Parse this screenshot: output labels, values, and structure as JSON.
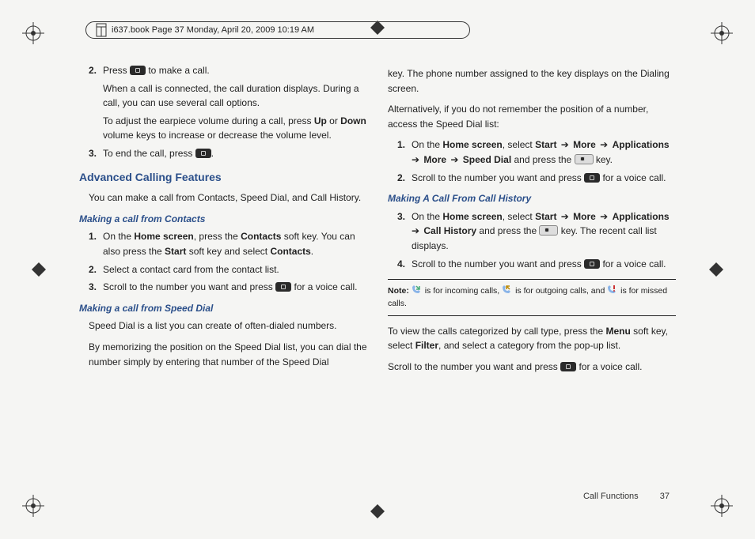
{
  "header": {
    "text": "i637.book  Page 37  Monday, April 20, 2009  10:19 AM"
  },
  "left": {
    "step2": {
      "num": "2.",
      "a": "Press ",
      "b": " to make a call."
    },
    "step2_p1": "When a call is connected, the call duration displays. During a call, you can use several call options.",
    "step2_p2a": "To adjust the earpiece volume during a call, press ",
    "step2_up": "Up",
    "step2_p2b": " or ",
    "step2_down": "Down",
    "step2_p2c": " volume keys to increase or decrease the volume level.",
    "step3": {
      "num": "3.",
      "a": "To end the call, press ",
      "b": "."
    },
    "sec_advanced": "Advanced Calling Features",
    "adv_intro": "You can make a call from Contacts, Speed Dial, and Call History.",
    "sub_contacts": "Making a call from Contacts",
    "c1": {
      "num": "1.",
      "a": "On the ",
      "home": "Home screen",
      "b": ", press the ",
      "contacts": "Contacts",
      "c": " soft key. You can also press the ",
      "start": "Start",
      "d": " soft key and select ",
      "contacts2": "Contacts",
      "e": "."
    },
    "c2": {
      "num": "2.",
      "a": "Select a contact card from the contact list."
    },
    "c3": {
      "num": "3.",
      "a": "Scroll to the number you want and press ",
      "b": " for a voice call."
    },
    "sub_speeddial": "Making a call from Speed Dial",
    "sd_p1": "Speed Dial is a list you can create of often-dialed numbers.",
    "sd_p2": "By memorizing the position on the Speed Dial list, you can dial the number simply by entering that number of the Speed Dial"
  },
  "right": {
    "top_p1": "key. The phone number assigned to the key displays on the Dialing screen.",
    "top_p2": "Alternatively, if you do not remember the position of a number, access the Speed Dial list:",
    "r1": {
      "num": "1.",
      "a": "On the ",
      "home": "Home screen",
      "b": ", select ",
      "start": "Start",
      "arr": " ➔ ",
      "more": "More",
      "apps": "Applications",
      "more2": "More",
      "sd": "Speed Dial",
      "c": " and press the ",
      "d": " key."
    },
    "r2": {
      "num": "2.",
      "a": "Scroll to the number you want and press ",
      "b": " for a voice call."
    },
    "sub_history": "Making A Call From Call History",
    "h3": {
      "num": "3.",
      "a": "On the ",
      "home": "Home screen",
      "b": ", select ",
      "start": "Start",
      "arr": " ➔ ",
      "more": "More",
      "apps": "Applications",
      "ch": "Call History",
      "c": " and press the ",
      "d": " key. The recent call list displays."
    },
    "h4": {
      "num": "4.",
      "a": "Scroll to the number you want and press ",
      "b": " for a voice call."
    },
    "note": {
      "label": "Note:",
      "a": " is for incoming calls, ",
      "b": " is for outgoing calls, and ",
      "c": " is for missed calls."
    },
    "view_p1a": "To view the calls categorized by call type, press the ",
    "view_menu": "Menu",
    "view_p1b": " soft key, select ",
    "view_filter": "Filter",
    "view_p1c": ", and select a category from the pop-up list.",
    "view_p2a": "Scroll to the number you want and press ",
    "view_p2b": " for a voice call."
  },
  "footer": {
    "section": "Call Functions",
    "page": "37"
  }
}
